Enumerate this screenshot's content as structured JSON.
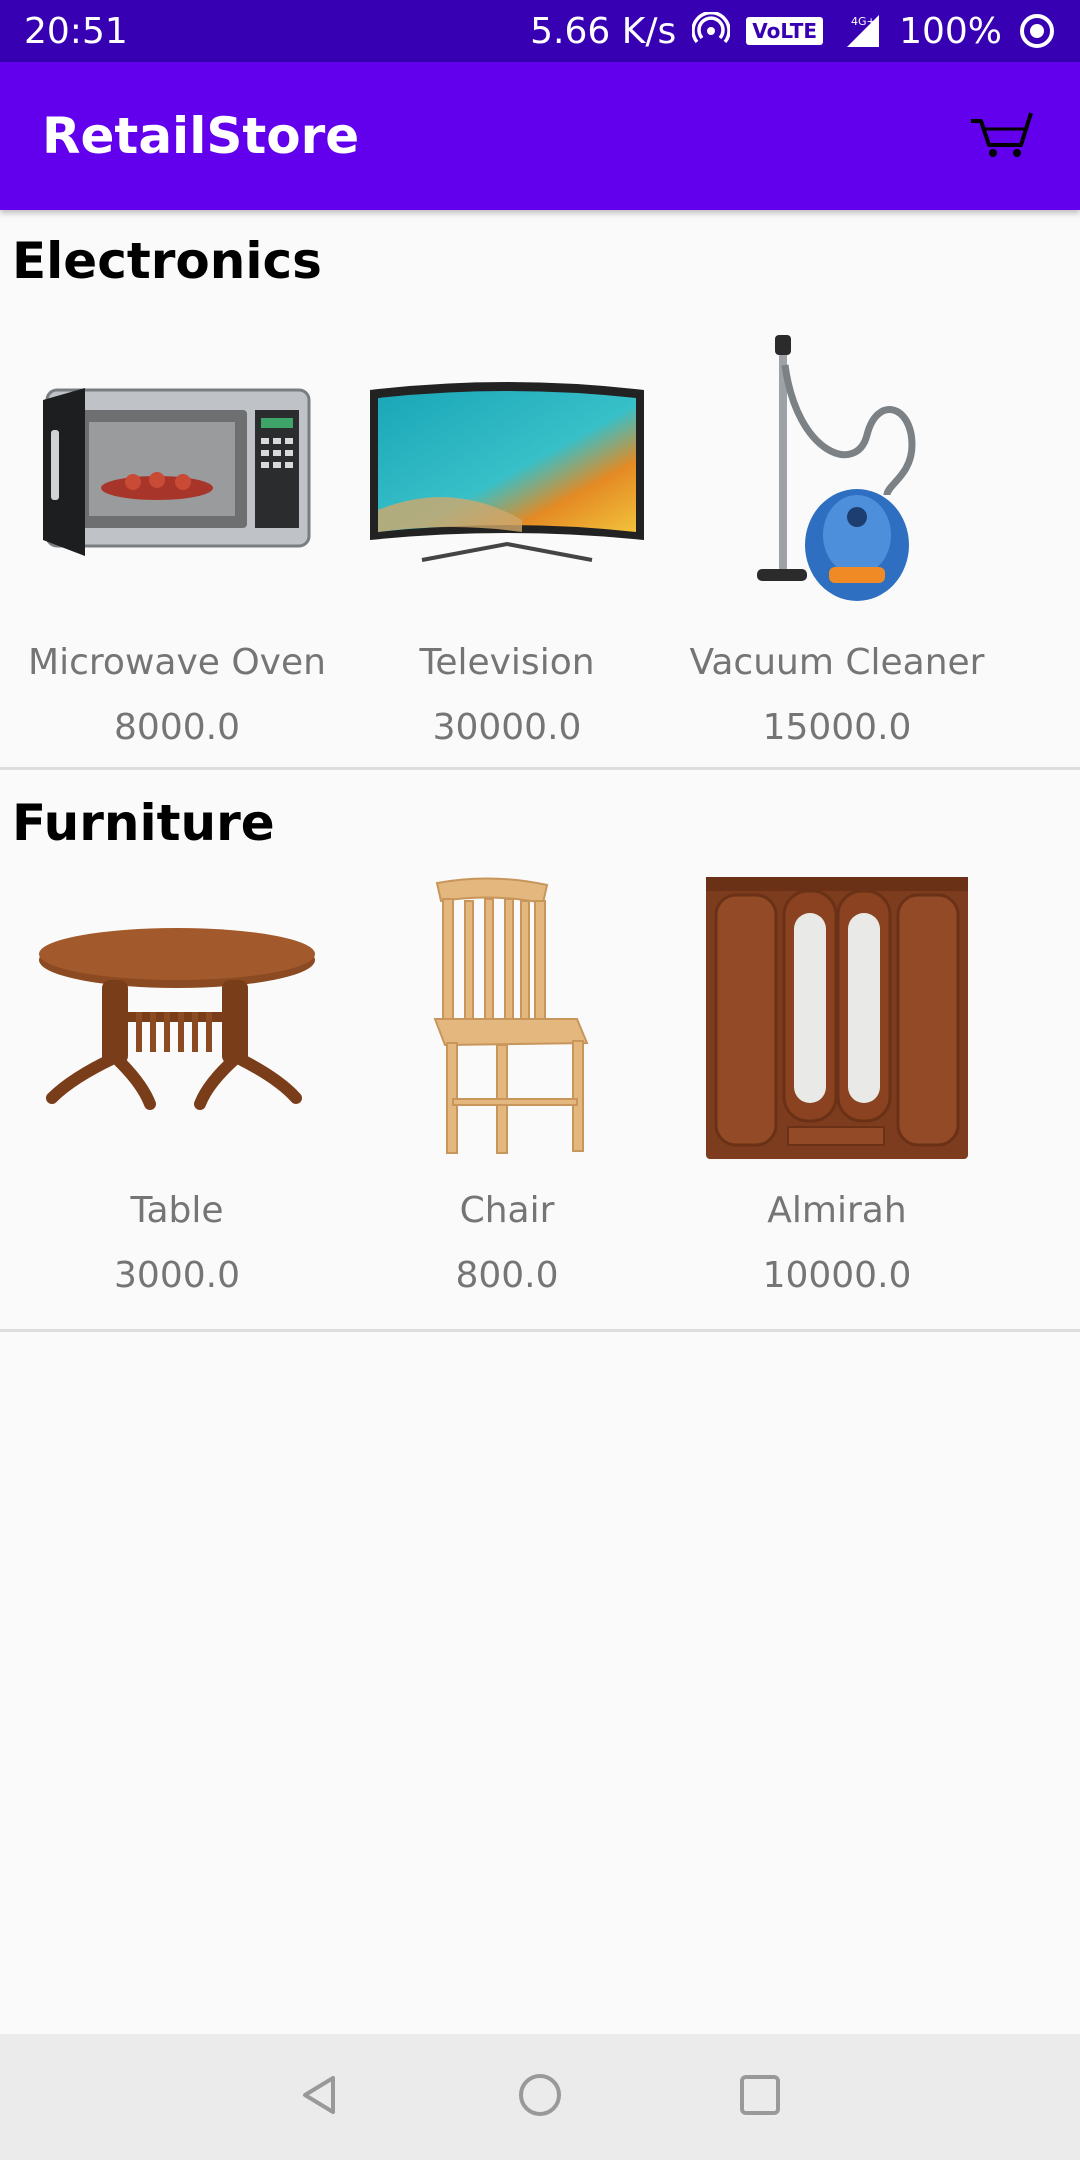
{
  "status_bar": {
    "time": "20:51",
    "net_speed": "5.66 K/s",
    "volte": "VoLTE",
    "network": "4G+",
    "battery": "100%"
  },
  "app_bar": {
    "title": "RetailStore",
    "cart_icon": "cart-icon"
  },
  "sections": [
    {
      "title": "Electronics",
      "items": [
        {
          "name": "Microwave Oven",
          "price": "8000.0"
        },
        {
          "name": "Television",
          "price": "30000.0"
        },
        {
          "name": "Vacuum Cleaner",
          "price": "15000.0"
        }
      ]
    },
    {
      "title": "Furniture",
      "items": [
        {
          "name": "Table",
          "price": "3000.0"
        },
        {
          "name": "Chair",
          "price": "800.0"
        },
        {
          "name": "Almirah",
          "price": "10000.0"
        }
      ]
    }
  ],
  "nav_bar": {
    "back_icon": "back-triangle-icon",
    "home_icon": "home-circle-icon",
    "recents_icon": "recents-square-icon"
  },
  "colors": {
    "status_bar": "#3700b3",
    "app_bar": "#6200ee",
    "background": "#fafafa",
    "secondary_text": "#757575"
  }
}
